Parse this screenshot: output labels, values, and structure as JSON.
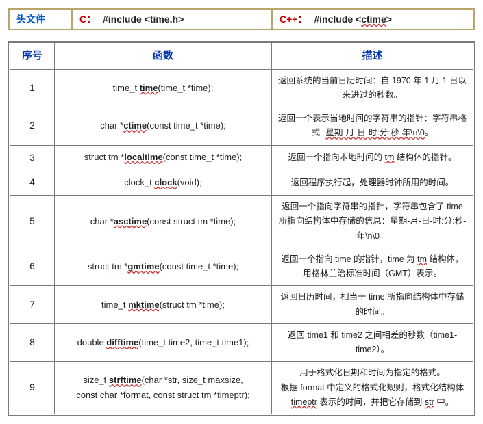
{
  "header": {
    "label": "头文件",
    "c_lang": "C：",
    "c_include": "#include <time.h>",
    "cpp_lang": "C++：",
    "cpp_include_prefix": "#include <",
    "cpp_include_name": "ctime",
    "cpp_include_suffix": ">"
  },
  "columns": {
    "num": "序号",
    "func": "函数",
    "desc": "描述"
  },
  "rows": [
    {
      "n": "1",
      "f_pre": "time_t ",
      "f_bold": "time",
      "f_post": "(time_t *time);",
      "d_parts": [
        "返回系统的当前日历时间：自 1970 年 1 月 1 日以来进过的秒数。"
      ]
    },
    {
      "n": "2",
      "f_pre": "char *",
      "f_bold": "ctime",
      "f_post": "(const time_t *time);",
      "d_parts": [
        "返回一个表示当地时间的字符串的指针：字符串格式--",
        "星期-月-日-时:分:秒-年\\n\\0",
        "。"
      ]
    },
    {
      "n": "3",
      "f_pre": "struct tm *",
      "f_bold": "localtime",
      "f_post": "(const time_t *time);",
      "d_parts": [
        "返回一个指向本地时间的 ",
        "tm",
        " 结构体的指针。"
      ]
    },
    {
      "n": "4",
      "f_pre": "clock_t ",
      "f_bold": "clock",
      "f_post": "(void);",
      "d_parts": [
        "返回程序执行起，处理器时钟所用的时间。"
      ]
    },
    {
      "n": "5",
      "f_pre": "char *",
      "f_bold": "asctime",
      "f_post": "(const struct tm *time);",
      "d_parts": [
        "返回一个指向字符串的指针，字符串包含了 time 所指向结构体中存储的信息：星期-月-日-时:分:秒-年\\n\\0。"
      ]
    },
    {
      "n": "6",
      "f_pre": "struct tm *",
      "f_bold": "gmtime",
      "f_post": "(const time_t *time);",
      "d_parts": [
        "返回一个指向 time 的指针，time 为 ",
        "tm",
        " 结构体，用格林兰治标准时间（GMT）表示。"
      ]
    },
    {
      "n": "7",
      "f_pre": "time_t ",
      "f_bold": "mktime",
      "f_post": "(struct tm *time);",
      "d_parts": [
        "返回日历时间，相当于 time 所指向结构体中存储的时间。"
      ]
    },
    {
      "n": "8",
      "f_pre": "double ",
      "f_bold": "difftime",
      "f_post": "(time_t time2, time_t time1);",
      "d_parts": [
        "返回 time1 和 time2 之间相差的秒数（time1-time2）。"
      ]
    },
    {
      "n": "9",
      "f_pre": "size_t ",
      "f_bold": "strftime",
      "f_post_line1": "(char *str, size_t maxsize,",
      "f_post_line2": "const char *format, const struct tm *timeptr);",
      "d_parts": [
        "用于格式化日期和时间为指定的格式。",
        "根据 format 中定义的格式化规则，格式化结构体 ",
        "timeptr",
        " 表示的时间，并把它存储到 ",
        "str",
        " 中。"
      ]
    }
  ]
}
